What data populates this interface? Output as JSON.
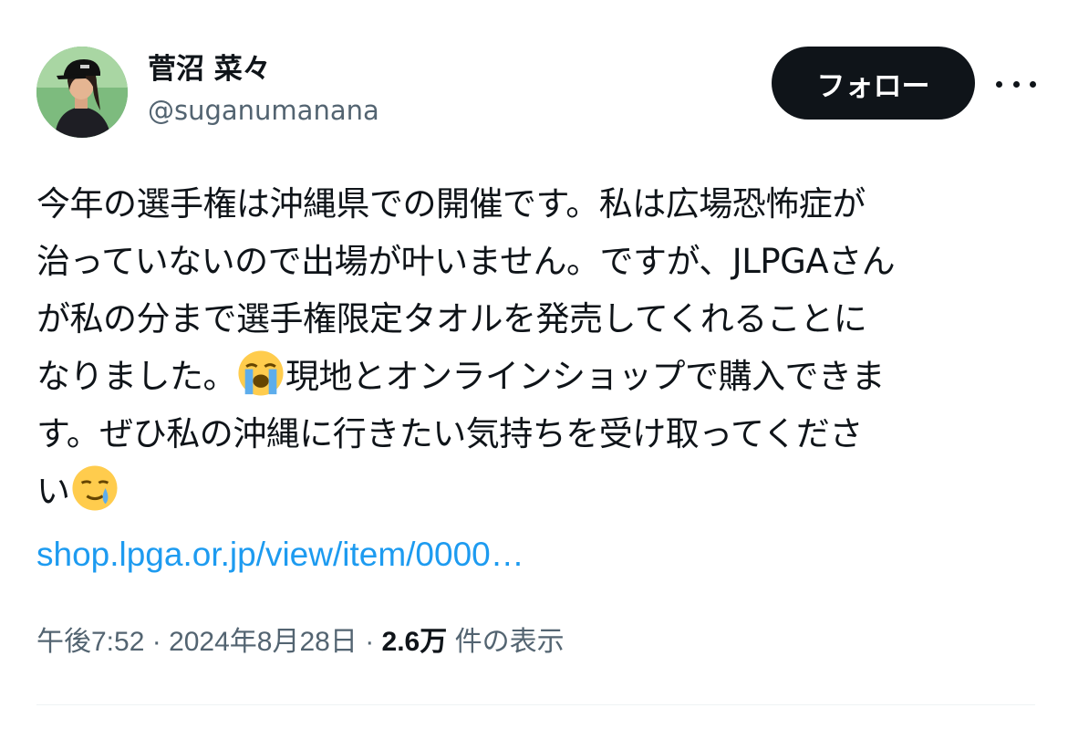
{
  "author": {
    "display_name": "菅沼 菜々",
    "handle": "@suganumanana"
  },
  "follow_label": "フォロー",
  "more_icon": "more-horizontal-icon",
  "tweet": {
    "lines": [
      "今年の選手権は沖縄県での開催です。私は広場恐怖症が",
      "治っていないので出場が叶いません。ですが、JLPGAさん",
      "が私の分まで選手権限定タオルを発売してくれることに",
      "なりました。",
      "現地とオンラインショップで購入できま",
      "す。ぜひ私の沖縄に行きたい気持ちを受け取ってくださ",
      "い"
    ],
    "emoji_crying": "loudly-crying-face-emoji",
    "emoji_holding_tears": "face-holding-back-tears-emoji",
    "link": "shop.lpga.or.jp/view/item/0000…"
  },
  "meta": {
    "time": "午後7:52",
    "sep1": " · ",
    "date": "2024年8月28日",
    "sep2": " · ",
    "views_count": "2.6万",
    "views_label": " 件の表示"
  },
  "colors": {
    "text": "#0f1419",
    "secondary": "#536471",
    "link": "#1d9bf0",
    "button_bg": "#0f1419"
  }
}
